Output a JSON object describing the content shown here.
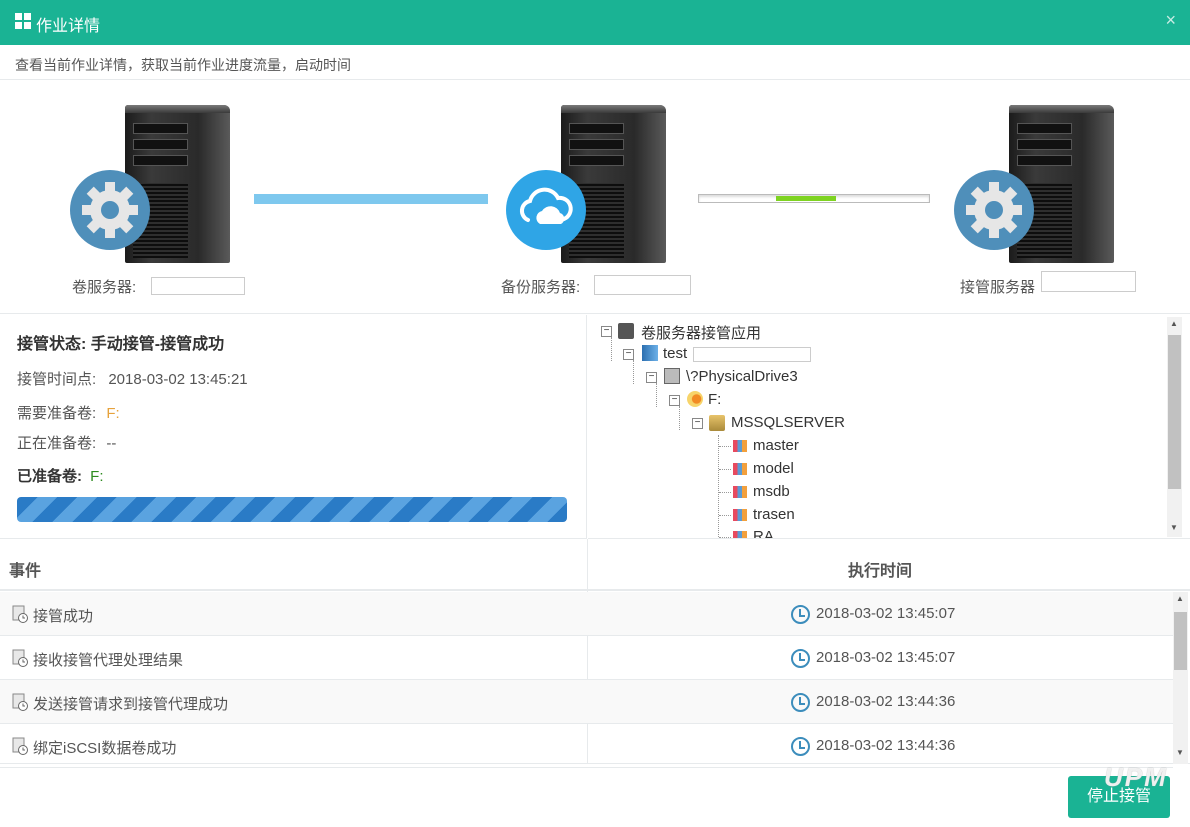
{
  "dialog": {
    "title": "作业详情",
    "close_glyph": "×",
    "description": "查看当前作业详情，获取当前作业进度流量，启动时间"
  },
  "servers": {
    "volume_label": "卷服务器:",
    "backup_label": "备份服务器:",
    "takeover_label": "接管服务器",
    "connection_1_state": "full",
    "connection_2_progress": 0.26
  },
  "status": {
    "state_label": "接管状态:",
    "state_value": "手动接管-接管成功",
    "time_label": "接管时间点:",
    "time_value": "2018-03-02 13:45:21",
    "need_label": "需要准备卷:",
    "need_value": "F:",
    "preparing_label": "正在准备卷:",
    "preparing_value": "--",
    "ready_label": "已准备卷:",
    "ready_value": "F:",
    "progress": 1.0
  },
  "tree": {
    "root": "卷服务器接管应用",
    "host": "test",
    "drive": "\\?PhysicalDrive3",
    "volume": "F:",
    "instance": "MSSQLSERVER",
    "databases": [
      "master",
      "model",
      "msdb",
      "trasen",
      "RA"
    ]
  },
  "events": {
    "col_event": "事件",
    "col_time": "执行时间",
    "rows": [
      {
        "event": "接管成功",
        "time": "2018-03-02 13:45:07"
      },
      {
        "event": "接收接管代理处理结果",
        "time": "2018-03-02 13:45:07"
      },
      {
        "event": "发送接管请求到接管代理成功",
        "time": "2018-03-02 13:44:36"
      },
      {
        "event": "绑定iSCSI数据卷成功",
        "time": "2018-03-02 13:44:36"
      }
    ]
  },
  "actions": {
    "stop_button": "停止接管"
  },
  "watermark": "UPM",
  "colors": {
    "header": "#1ab394",
    "success_text": "#2e8b1f",
    "warning_text": "#e6a23c",
    "progress_bar": "#2a7bc6",
    "link_line": "#7ec8ee",
    "flow_fill": "#7ed321"
  },
  "icons": {
    "title": "grid-icon",
    "server_badge_1": "gear-icon",
    "server_badge_2": "cloud-icon",
    "server_badge_3": "gear-icon",
    "event": "event-log-icon",
    "time": "clock-icon"
  }
}
